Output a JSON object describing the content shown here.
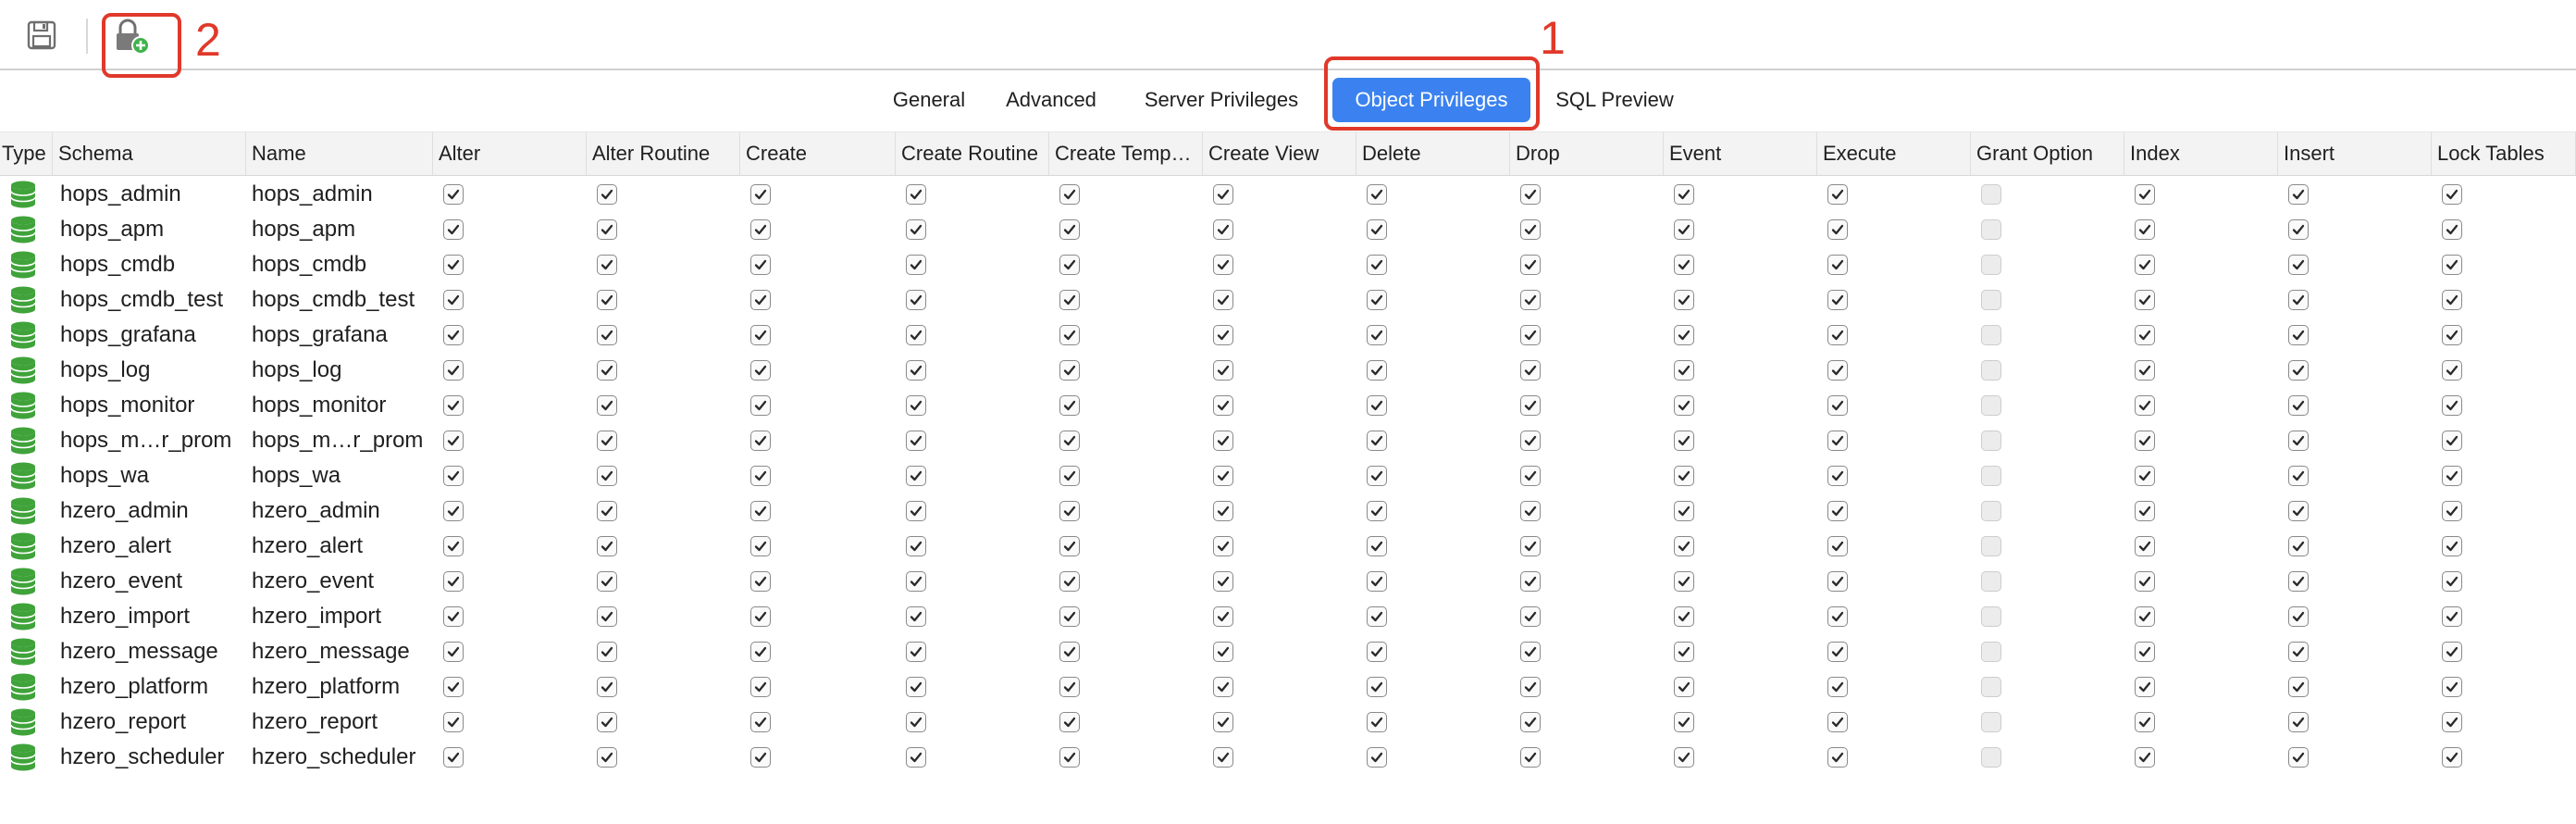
{
  "toolbar": {
    "save_icon": "floppy-disk-icon",
    "add_privilege_icon": "lock-add-icon"
  },
  "annotations": {
    "callout_1": "1",
    "callout_2": "2",
    "color": "#e0392b"
  },
  "tabs": [
    {
      "label": "General",
      "active": false
    },
    {
      "label": "Advanced",
      "active": false
    },
    {
      "label": "Server Privileges",
      "active": false
    },
    {
      "label": "Object Privileges",
      "active": true
    },
    {
      "label": "SQL Preview",
      "active": false
    }
  ],
  "accent_color": "#3b82f0",
  "table": {
    "columns": [
      "Type",
      "Schema",
      "Name",
      "Alter",
      "Alter Routine",
      "Create",
      "Create Routine",
      "Create Temp…",
      "Create View",
      "Delete",
      "Drop",
      "Event",
      "Execute",
      "Grant Option",
      "Index",
      "Insert",
      "Lock Tables"
    ],
    "type_icon": "database-icon",
    "rows": [
      {
        "schema": "hops_admin",
        "name": "hops_admin"
      },
      {
        "schema": "hops_apm",
        "name": "hops_apm"
      },
      {
        "schema": "hops_cmdb",
        "name": "hops_cmdb"
      },
      {
        "schema": "hops_cmdb_test",
        "name": "hops_cmdb_test"
      },
      {
        "schema": "hops_grafana",
        "name": "hops_grafana"
      },
      {
        "schema": "hops_log",
        "name": "hops_log"
      },
      {
        "schema": "hops_monitor",
        "name": "hops_monitor"
      },
      {
        "schema": "hops_m…r_prom",
        "name": "hops_m…r_prom"
      },
      {
        "schema": "hops_wa",
        "name": "hops_wa"
      },
      {
        "schema": "hzero_admin",
        "name": "hzero_admin"
      },
      {
        "schema": "hzero_alert",
        "name": "hzero_alert"
      },
      {
        "schema": "hzero_event",
        "name": "hzero_event"
      },
      {
        "schema": "hzero_import",
        "name": "hzero_import"
      },
      {
        "schema": "hzero_message",
        "name": "hzero_message"
      },
      {
        "schema": "hzero_platform",
        "name": "hzero_platform"
      },
      {
        "schema": "hzero_report",
        "name": "hzero_report"
      },
      {
        "schema": "hzero_scheduler",
        "name": "hzero_scheduler"
      }
    ],
    "privileges_state": {
      "Alter": true,
      "Alter Routine": true,
      "Create": true,
      "Create Routine": true,
      "Create Temp…": true,
      "Create View": true,
      "Delete": true,
      "Drop": true,
      "Event": true,
      "Execute": true,
      "Grant Option": false,
      "Index": true,
      "Insert": true,
      "Lock Tables": true
    }
  }
}
